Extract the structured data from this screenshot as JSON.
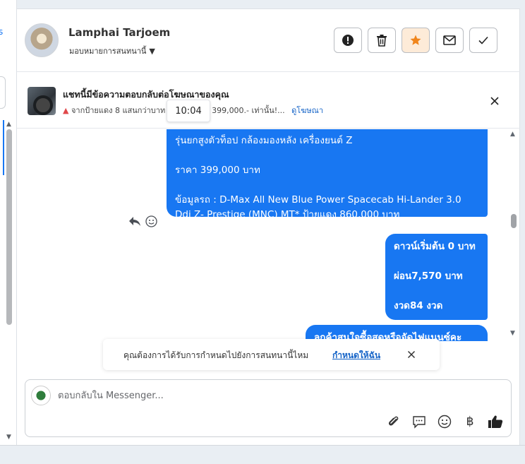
{
  "left_panel": {
    "fragment": "s"
  },
  "header": {
    "name": "Lamphai Tarjoem",
    "assign_label": "มอบหมายการสนทนานี้",
    "actions": [
      {
        "name": "alert-button",
        "icon": "exclamation-icon"
      },
      {
        "name": "delete-button",
        "icon": "trash-icon"
      },
      {
        "name": "star-button",
        "icon": "star-icon"
      },
      {
        "name": "mark-unread-button",
        "icon": "envelope-icon"
      },
      {
        "name": "done-button",
        "icon": "check-icon"
      }
    ]
  },
  "ad_bar": {
    "title": "แชทนี้มีข้อความตอบกลับต่อโฆษณาของคุณ",
    "subtitle_prefix": "จากป้ายแดง 8 แสนกว่าบาท",
    "subtitle_suffix": "อเพียงแค่... 399,000.- เท่านั้น!...",
    "view_ad": "ดูโฆษณา",
    "tooltip_time": "10:04"
  },
  "messages": [
    {
      "lines": [
        " รุ่นยกสูงตัวท็อป กล้องมองหลัง เครื่องยนต์ Z",
        "ราคา 399,000 บาท",
        "ข้อมูลรถ : D-Max All New Blue Power Spacecab Hi-Lander 3.0 Ddi Z- Prestige (MNC) MT* ป้ายแดง 860,000 บาท"
      ]
    },
    {
      "lines": [
        "ดาวน์เริ่มต้น 0 บาท",
        "ผ่อน7,570 บาท",
        "งวด84 งวด"
      ]
    },
    {
      "lines": [
        "ลูกค้าสนใจซื้อสดหรือจัดไฟแนนซ์คะ"
      ]
    }
  ],
  "notification": {
    "text": "คุณต้องการได้รับการกำหนดไปยังการสนทนานี้ไหม",
    "link": "กำหนดให้ฉัน"
  },
  "composer": {
    "placeholder": "ตอบกลับใน Messenger...",
    "tools": [
      "paperclip-icon",
      "speech-bubble-icon",
      "emoji-icon",
      "baht-icon",
      "thumbs-up-icon"
    ],
    "baht_symbol": "฿"
  },
  "colors": {
    "accent": "#1877f2",
    "star": "#f0851b"
  }
}
